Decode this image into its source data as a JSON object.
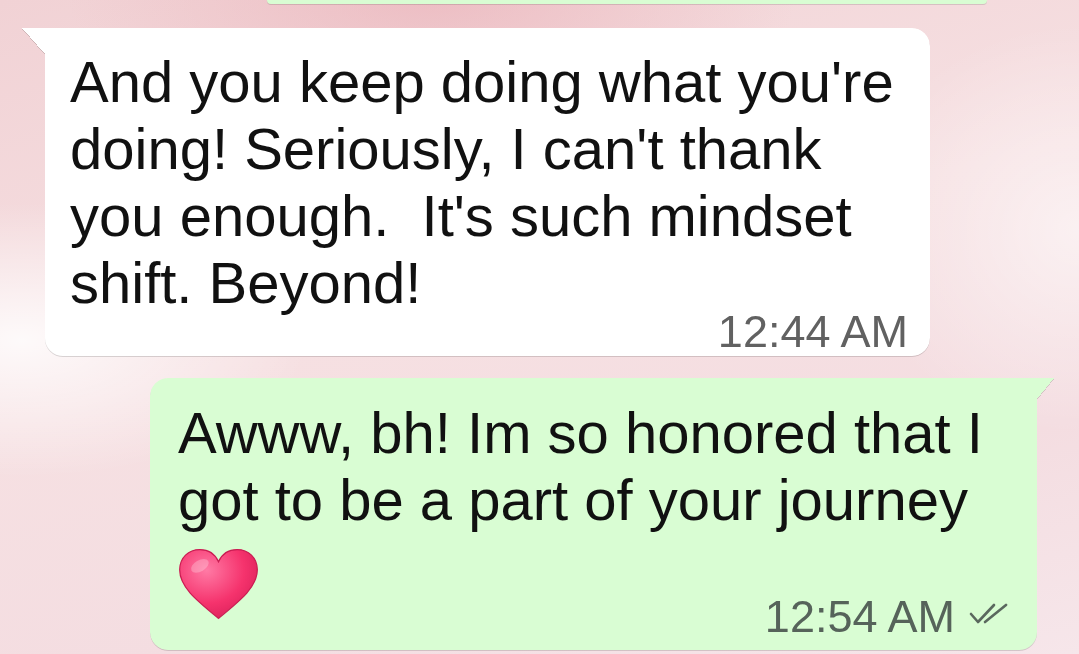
{
  "messages": [
    {
      "kind": "outgoing"
    },
    {
      "kind": "incoming",
      "text": "And you keep doing what you're doing! Seriously, I can't thank you enough.  It's such mindset shift. Beyond!",
      "time": "12:44 AM"
    },
    {
      "kind": "outgoing",
      "text": "Awww, bh! Im so honored that I got to be a part of your journey",
      "emoji": true,
      "time": "12:54 AM",
      "delivered": true,
      "read": false
    }
  ]
}
